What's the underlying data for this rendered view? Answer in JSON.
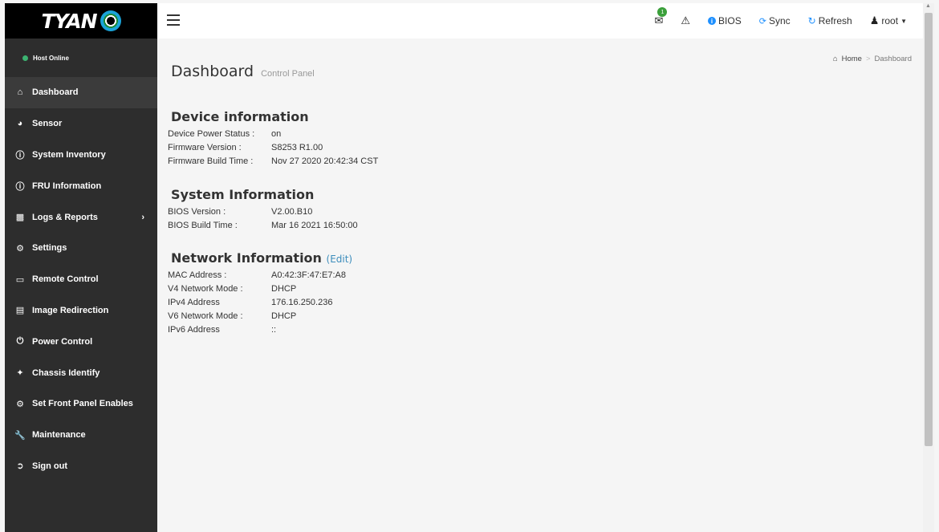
{
  "brand": {
    "logo_text": "TYAN"
  },
  "host": {
    "status": "Host Online",
    "status_color": "#3cb371"
  },
  "sidebar": {
    "items": [
      {
        "label": "Dashboard",
        "icon": "home-icon",
        "active": true
      },
      {
        "label": "Sensor",
        "icon": "dashboard-gauge-icon"
      },
      {
        "label": "System Inventory",
        "icon": "info-circle-icon"
      },
      {
        "label": "FRU Information",
        "icon": "info-circle-icon"
      },
      {
        "label": "Logs & Reports",
        "icon": "bar-chart-icon",
        "has_submenu": true
      },
      {
        "label": "Settings",
        "icon": "gear-icon"
      },
      {
        "label": "Remote Control",
        "icon": "monitor-icon"
      },
      {
        "label": "Image Redirection",
        "icon": "hdd-icon"
      },
      {
        "label": "Power Control",
        "icon": "power-icon"
      },
      {
        "label": "Chassis Identify",
        "icon": "wrench-icon"
      },
      {
        "label": "Set Front Panel Enables",
        "icon": "gears-icon"
      },
      {
        "label": "Maintenance",
        "icon": "wrench-icon"
      },
      {
        "label": "Sign out",
        "icon": "sign-out-icon"
      }
    ]
  },
  "topbar": {
    "notification_count": "1",
    "bios_label": "BIOS",
    "sync_label": "Sync",
    "refresh_label": "Refresh",
    "user_label": "root"
  },
  "page": {
    "title": "Dashboard",
    "subtitle": "Control Panel",
    "breadcrumb_home": "Home",
    "breadcrumb_current": "Dashboard"
  },
  "device": {
    "heading": "Device information",
    "rows": [
      {
        "label": "Device Power Status :",
        "value": "on"
      },
      {
        "label": "Firmware Version :",
        "value": "S8253 R1.00"
      },
      {
        "label": "Firmware Build Time :",
        "value": "Nov 27 2020 20:42:34 CST"
      }
    ]
  },
  "system": {
    "heading": "System Information",
    "rows": [
      {
        "label": "BIOS Version :",
        "value": "V2.00.B10"
      },
      {
        "label": "BIOS Build Time :",
        "value": "Mar 16 2021 16:50:00"
      }
    ]
  },
  "network": {
    "heading": "Network Information",
    "edit_label": "(Edit)",
    "rows": [
      {
        "label": "MAC Address :",
        "value": "A0:42:3F:47:E7:A8"
      },
      {
        "label": "V4 Network Mode :",
        "value": "DHCP"
      },
      {
        "label": "IPv4 Address",
        "value": "176.16.250.236"
      },
      {
        "label": "V6 Network Mode :",
        "value": "DHCP"
      },
      {
        "label": "IPv6 Address",
        "value": "::"
      }
    ]
  }
}
